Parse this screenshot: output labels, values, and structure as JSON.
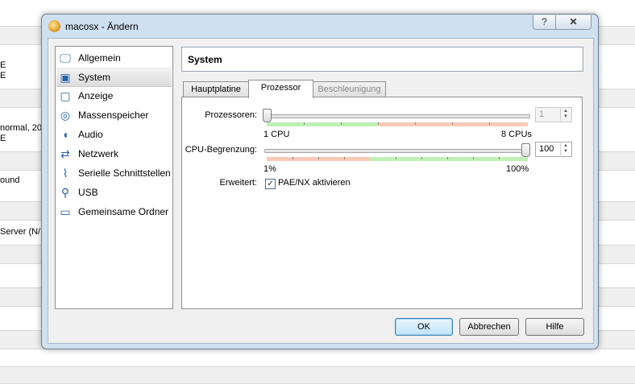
{
  "background": {
    "fragments": [
      "E",
      "E",
      "normal, 20,",
      "E",
      "ound",
      "Server (N/"
    ]
  },
  "dialog": {
    "title": "macosx - Ändern",
    "help_label": "?",
    "close_label": "✕"
  },
  "sidebar": {
    "items": [
      {
        "label": "Allgemein",
        "icon": "monitor-icon",
        "selected": false
      },
      {
        "label": "System",
        "icon": "chip-icon",
        "selected": true
      },
      {
        "label": "Anzeige",
        "icon": "display-icon",
        "selected": false
      },
      {
        "label": "Massenspeicher",
        "icon": "disk-icon",
        "selected": false
      },
      {
        "label": "Audio",
        "icon": "speaker-icon",
        "selected": false
      },
      {
        "label": "Netzwerk",
        "icon": "network-icon",
        "selected": false
      },
      {
        "label": "Serielle Schnittstellen",
        "icon": "serial-port-icon",
        "selected": false
      },
      {
        "label": "USB",
        "icon": "usb-icon",
        "selected": false
      },
      {
        "label": "Gemeinsame Ordner",
        "icon": "folder-icon",
        "selected": false
      }
    ]
  },
  "page": {
    "title": "System",
    "tabs": [
      {
        "label": "Hauptplatine",
        "state": "normal"
      },
      {
        "label": "Prozessor",
        "state": "active"
      },
      {
        "label": "Beschleunigung",
        "state": "disabled"
      }
    ]
  },
  "processor": {
    "processors_label": "Prozessoren:",
    "processors_value": "1",
    "processors_min_label": "1 CPU",
    "processors_max_label": "8 CPUs",
    "processors_level": 0,
    "cpu_limit_label": "CPU-Begrenzung:",
    "cpu_limit_value": "100",
    "cpu_limit_min_label": "1%",
    "cpu_limit_max_label": "100%",
    "cpu_limit_level": 1,
    "extended_label": "Erweitert:",
    "pae_label": "PAE/NX aktivieren",
    "pae_checked": true
  },
  "buttons": {
    "ok": "OK",
    "cancel": "Abbrechen",
    "help": "Hilfe"
  },
  "colors": {
    "scale_green": "#bff0b5",
    "scale_red": "#f8c9b6",
    "dialog_frame": "#cfe0f1"
  }
}
